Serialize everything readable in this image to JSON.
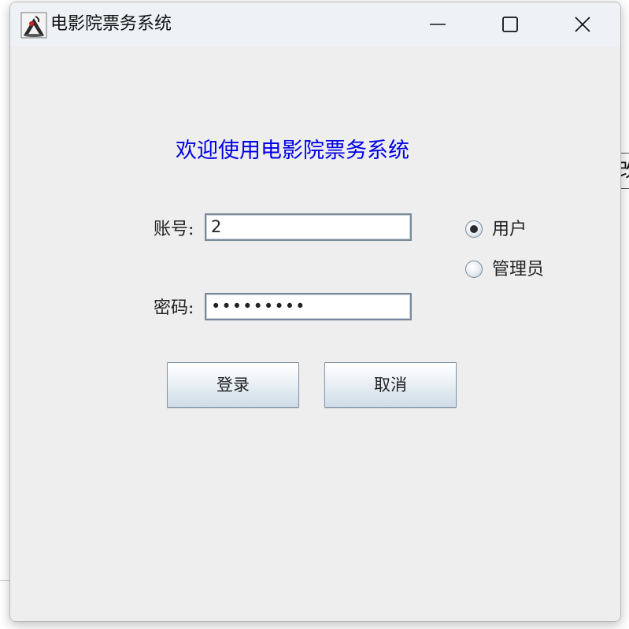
{
  "window": {
    "title": "电影院票务系统",
    "controls": [
      "minimize-icon",
      "maximize-icon",
      "close-icon"
    ]
  },
  "form": {
    "heading": "欢迎使用电影院票务系统",
    "account": {
      "label": "账号:",
      "value": "2"
    },
    "password": {
      "label": "密码:",
      "value": "•••••••••"
    },
    "roles": [
      {
        "label": "用户",
        "selected": true
      },
      {
        "label": "管理员",
        "selected": false
      }
    ],
    "login_label": "登录",
    "cancel_label": "取消"
  },
  "background_fragment": {
    "text": "改"
  },
  "colors": {
    "heading": "#0000e6",
    "window_bg": "#eeeeee",
    "titlebar_bg": "#eef2f6"
  }
}
